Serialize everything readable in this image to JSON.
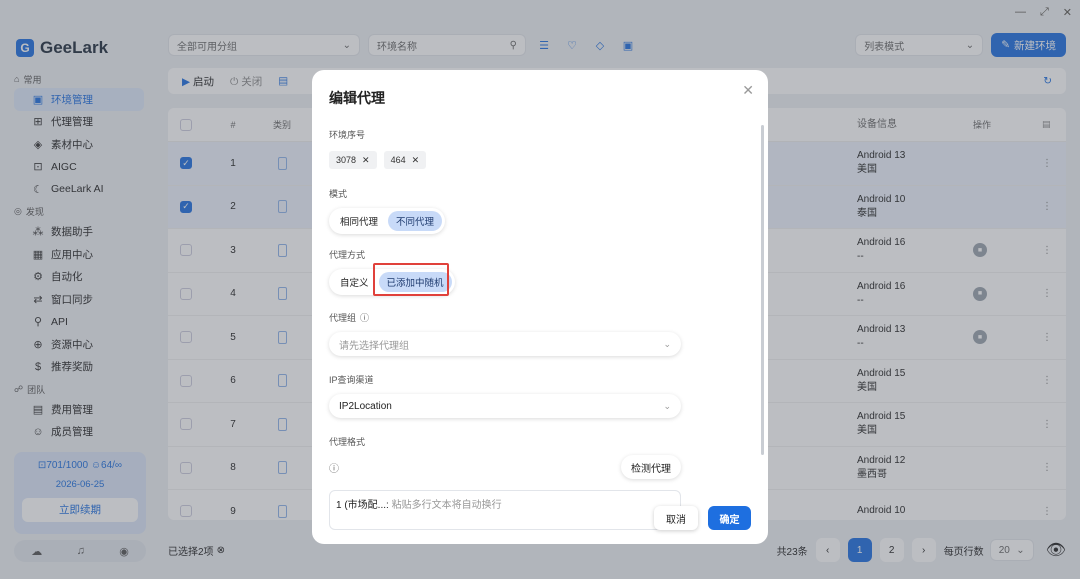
{
  "app": {
    "name": "GeeLark",
    "logo_glyph": "G"
  },
  "window_controls": [
    "—",
    "⤢",
    "✕"
  ],
  "sidebar": {
    "sections": [
      {
        "title": "常用",
        "items": [
          {
            "label": "环境管理",
            "icon": "environment-icon",
            "active": true
          },
          {
            "label": "代理管理",
            "icon": "proxy-icon"
          },
          {
            "label": "素材中心",
            "icon": "material-icon"
          },
          {
            "label": "AIGC",
            "icon": "aigc-icon"
          },
          {
            "label": "GeeLark AI",
            "icon": "ai-icon"
          }
        ]
      },
      {
        "title": "发现",
        "items": [
          {
            "label": "数据助手",
            "icon": "data-icon"
          },
          {
            "label": "应用中心",
            "icon": "apps-icon"
          },
          {
            "label": "自动化",
            "icon": "automation-icon"
          },
          {
            "label": "窗口同步",
            "icon": "sync-icon"
          },
          {
            "label": "API",
            "icon": "api-icon"
          },
          {
            "label": "资源中心",
            "icon": "resource-icon"
          },
          {
            "label": "推荐奖励",
            "icon": "reward-icon"
          }
        ]
      },
      {
        "title": "团队",
        "items": [
          {
            "label": "费用管理",
            "icon": "billing-icon"
          },
          {
            "label": "成员管理",
            "icon": "members-icon"
          }
        ]
      }
    ],
    "quota": {
      "envs": "701/1000",
      "members": "64/∞",
      "expiry": "2026-06-25",
      "renew_label": "立即续期"
    }
  },
  "topbar": {
    "group_select": "全部可用分组",
    "env_search_placeholder": "环境名称",
    "view_mode": "列表模式",
    "new_env_label": "新建环境"
  },
  "toolbar": {
    "start_label": "启动",
    "close_label": "关闭"
  },
  "table": {
    "headers": {
      "no": "#",
      "type": "类别",
      "device": "设备信息",
      "action": "操作"
    },
    "rows": [
      {
        "no": "1",
        "selected": true,
        "os": "Android 13",
        "region": "美国",
        "locked": false
      },
      {
        "no": "2",
        "selected": true,
        "os": "Android 10",
        "region": "泰国",
        "locked": false
      },
      {
        "no": "3",
        "selected": false,
        "os": "Android 16",
        "region": "--",
        "locked": true
      },
      {
        "no": "4",
        "selected": false,
        "os": "Android 16",
        "region": "--",
        "locked": true
      },
      {
        "no": "5",
        "selected": false,
        "os": "Android 13",
        "region": "--",
        "locked": true
      },
      {
        "no": "6",
        "selected": false,
        "os": "Android 15",
        "region": "美国",
        "locked": false
      },
      {
        "no": "7",
        "selected": false,
        "os": "Android 15",
        "region": "美国",
        "locked": false
      },
      {
        "no": "8",
        "selected": false,
        "os": "Android 12",
        "region": "墨西哥",
        "locked": false
      },
      {
        "no": "9",
        "selected": false,
        "os": "Android 10",
        "region": "",
        "locked": false
      }
    ]
  },
  "footer": {
    "selected_text": "已选择2项",
    "total_text": "共23条",
    "pages": [
      "1",
      "2"
    ],
    "current_page": "1",
    "page_size_label": "每页行数",
    "page_size": "20"
  },
  "modal": {
    "title": "编辑代理",
    "env_no_label": "环境序号",
    "env_tags": [
      "3078",
      "464"
    ],
    "mode_label": "模式",
    "mode_options": [
      "相同代理",
      "不同代理"
    ],
    "mode_selected": "不同代理",
    "method_label": "代理方式",
    "method_options": [
      "自定义",
      "已添加中随机"
    ],
    "method_selected": "已添加中随机",
    "group_label": "代理组",
    "group_placeholder": "请先选择代理组",
    "ip_channel_label": "IP查询渠道",
    "ip_channel_value": "IP2Location",
    "format_label": "代理格式",
    "check_proxy_label": "检测代理",
    "textarea_prefix": "1 (市场配...:",
    "textarea_placeholder": "粘贴多行文本将自动换行",
    "cancel_label": "取消",
    "ok_label": "确定"
  },
  "colors": {
    "accent": "#1e6fe0",
    "highlight": "#e0413b"
  }
}
